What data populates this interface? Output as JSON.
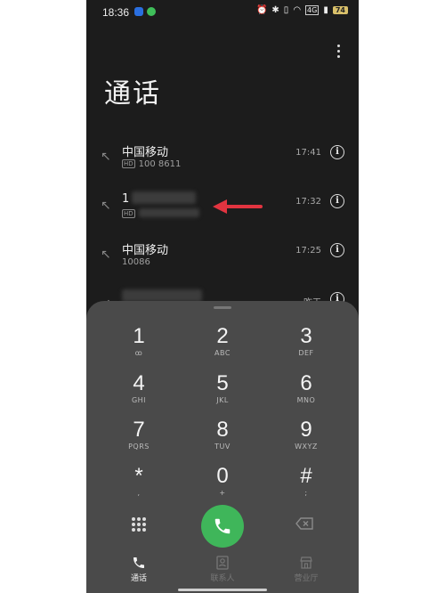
{
  "status": {
    "time": "18:36",
    "battery": "74",
    "network": "4G"
  },
  "title": "通话",
  "calls": [
    {
      "name": "中国移动",
      "sim": "HD",
      "number": "100 8611",
      "time": "17:41"
    },
    {
      "name": "1",
      "sim": "HD",
      "number": "",
      "time": "17:32"
    },
    {
      "name": "中国移动",
      "sim": "",
      "number": "10086",
      "time": "17:25"
    },
    {
      "name": "",
      "sim": "",
      "number": "",
      "time": "昨天"
    }
  ],
  "keys": [
    {
      "digit": "1",
      "letters": "ꝏ"
    },
    {
      "digit": "2",
      "letters": "ABC"
    },
    {
      "digit": "3",
      "letters": "DEF"
    },
    {
      "digit": "4",
      "letters": "GHI"
    },
    {
      "digit": "5",
      "letters": "JKL"
    },
    {
      "digit": "6",
      "letters": "MNO"
    },
    {
      "digit": "7",
      "letters": "PQRS"
    },
    {
      "digit": "8",
      "letters": "TUV"
    },
    {
      "digit": "9",
      "letters": "WXYZ"
    },
    {
      "digit": "*",
      "letters": ","
    },
    {
      "digit": "0",
      "letters": "+"
    },
    {
      "digit": "#",
      "letters": ";"
    }
  ],
  "tabs": [
    {
      "label": "通话",
      "icon": "phone-icon",
      "active": true
    },
    {
      "label": "联系人",
      "icon": "contacts-icon",
      "active": false
    },
    {
      "label": "营业厅",
      "icon": "store-icon",
      "active": false
    }
  ],
  "colors": {
    "dial_button": "#3fb65a",
    "annotation_arrow": "#e23440"
  }
}
